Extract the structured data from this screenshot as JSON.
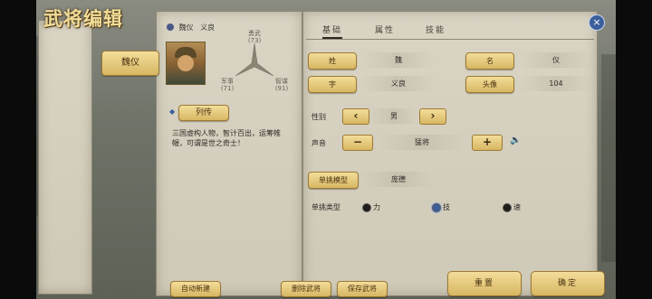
{
  "title": "武将编辑",
  "left_tag": "魏仪",
  "header": {
    "name": "魏仪",
    "style": "义良"
  },
  "stats": {
    "top_label": "勇武",
    "top_value": "(73)",
    "left_label": "军事",
    "left_value": "(71)",
    "right_label": "智谋",
    "right_value": "(91)"
  },
  "bio": {
    "button": "列传",
    "text": "三国虚构人物，智计百出，运筹帷幄，可谓是世之奇士！"
  },
  "tabs": [
    "基础",
    "属性",
    "技能"
  ],
  "form": {
    "surname_label": "姓",
    "surname": "魏",
    "given_label": "名",
    "given": "仪",
    "style_label": "字",
    "style": "义良",
    "portrait_label": "头像",
    "portrait": "104",
    "gender_label": "性别",
    "gender": "男",
    "voice_label": "声音",
    "voice": "猛将",
    "model_label": "单挑模型",
    "model": "庞德",
    "duel_label": "单挑类型",
    "duel_options": [
      "力",
      "技",
      "速"
    ],
    "duel_selected": "技"
  },
  "buttons": {
    "auto_create": "自动新建",
    "delete": "删除武将",
    "save": "保存武将",
    "reset": "重置",
    "confirm": "确定",
    "close": "×",
    "prev": "‹",
    "next": "›",
    "minus": "−",
    "plus": "+"
  },
  "colors": {
    "gold": "#e8cc80",
    "accent": "#3b5f9c"
  }
}
